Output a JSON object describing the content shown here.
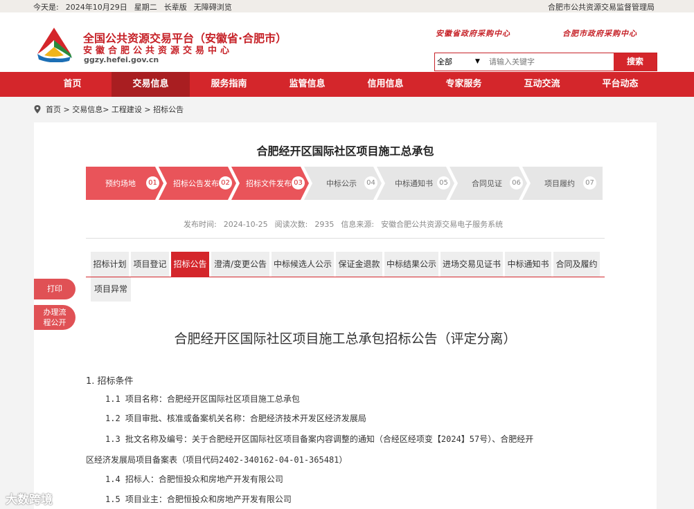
{
  "topbar": {
    "today_label": "今天是:",
    "date": "2024年10月29日",
    "weekday": "星期二",
    "version": "长辈版",
    "accessibility": "无障碍浏览",
    "right_link": "合肥市公共资源交易监督管理局"
  },
  "header": {
    "title": "全国公共资源交易平台（安徽省·合肥市）",
    "subtitle": "安徽合肥公共资源交易中心",
    "url": "ggzy.hefei.gov.cn",
    "link1": "安徽省政府采购中心",
    "link2": "合肥市政府采购中心",
    "search": {
      "select_value": "全部",
      "placeholder": "请输入关键字",
      "button": "搜索"
    }
  },
  "nav": [
    "首页",
    "交易信息",
    "服务指南",
    "监管信息",
    "信用信息",
    "专家服务",
    "互动交流",
    "平台动态"
  ],
  "breadcrumb": "首页 > 交易信息> 工程建设 > 招标公告",
  "project_title": "合肥经开区国际社区项目施工总承包",
  "steps": [
    {
      "label": "预约场地",
      "num": "01",
      "done": true
    },
    {
      "label": "招标公告发布",
      "num": "02",
      "done": true
    },
    {
      "label": "招标文件发布",
      "num": "03",
      "done": true
    },
    {
      "label": "中标公示",
      "num": "04",
      "done": false
    },
    {
      "label": "中标通知书",
      "num": "05",
      "done": false
    },
    {
      "label": "合同见证",
      "num": "06",
      "done": false
    },
    {
      "label": "项目履约",
      "num": "07",
      "done": false
    }
  ],
  "meta": {
    "publish_label": "发布时间:",
    "publish_date": "2024-10-25",
    "views_label": "阅读次数:",
    "views": "2935",
    "source_label": "信息来源:",
    "source": "安徽合肥公共资源交易电子服务系统"
  },
  "tabs": [
    "招标计划",
    "项目登记",
    "招标公告",
    "澄清/变更公告",
    "中标候选人公示",
    "保证金退款",
    "中标结果公示",
    "进场交易见证书",
    "中标通知书",
    "合同及履约",
    "项目异常"
  ],
  "side": {
    "print": "打印",
    "process_line1": "办理流",
    "process_line2": "程公开"
  },
  "doc": {
    "title": "合肥经开区国际社区项目施工总承包招标公告（评定分离）",
    "section1": "1.  招标条件",
    "l11": "1.1 项目名称：合肥经开区国际社区项目施工总承包",
    "l12": "1.2 项目审批、核准或备案机关名称：合肥经济技术开发区经济发展局",
    "l13a": "1.3 批文名称及编号：关于合肥经开区国际社区项目备案内容调整的通知（合经区经项变【2024】57号）、合肥经开",
    "l13b": "区经济发展局项目备案表（项目代码2402-340162-04-01-365481）",
    "l14": "1.4 招标人：合肥恒投众和房地产开发有限公司",
    "l15": "1.5 项目业主：合肥恒投众和房地产开发有限公司"
  },
  "watermark": "大数跨境",
  "colors": {
    "brand": "#d4262b",
    "nav_active": "#a91e21",
    "step_pending": "#e6e6e6"
  }
}
